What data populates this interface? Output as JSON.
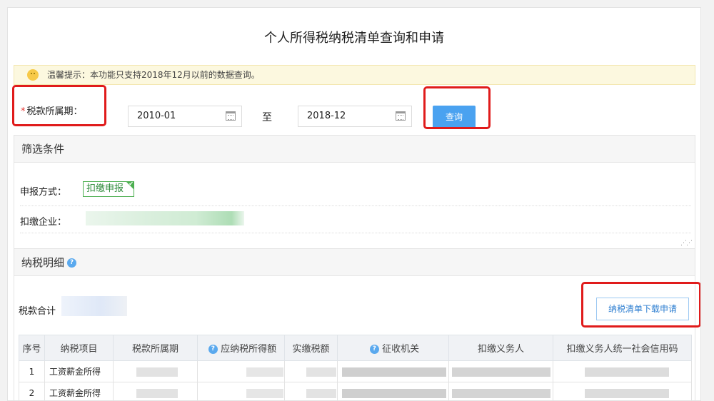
{
  "page": {
    "title": "个人所得税纳税清单查询和申请"
  },
  "notice": {
    "text": "温馨提示：本功能只支持2018年12月以前的数据查询。"
  },
  "query": {
    "period_label": "税款所属期：",
    "required_mark": "*",
    "start_value": "2010-01",
    "separator": "至",
    "end_value": "2018-12",
    "query_button": "查询"
  },
  "filter": {
    "heading": "筛选条件",
    "declare_label": "申报方式：",
    "declare_tag": "扣缴申报",
    "company_label": "扣缴企业："
  },
  "detail": {
    "heading": "纳税明细",
    "help_icon": "?",
    "total_label": "税款合计",
    "download_button": "纳税清单下载申请",
    "columns": [
      "序号",
      "纳税项目",
      "税款所属期",
      "应纳税所得额",
      "实缴税额",
      "征收机关",
      "扣缴义务人",
      "扣缴义务人统一社会信用码"
    ],
    "rows": [
      {
        "no": "1",
        "item": "工资薪金所得"
      },
      {
        "no": "2",
        "item": "工资薪金所得"
      }
    ]
  },
  "colors": {
    "accent": "#4aa2f0",
    "highlight_red": "#e01b1b",
    "tag_green": "#4caf50",
    "notice_bg": "#fcf8df"
  },
  "icons": [
    "smile-icon",
    "calendar-icon",
    "help-icon",
    "check-icon",
    "resize-grip-icon"
  ]
}
